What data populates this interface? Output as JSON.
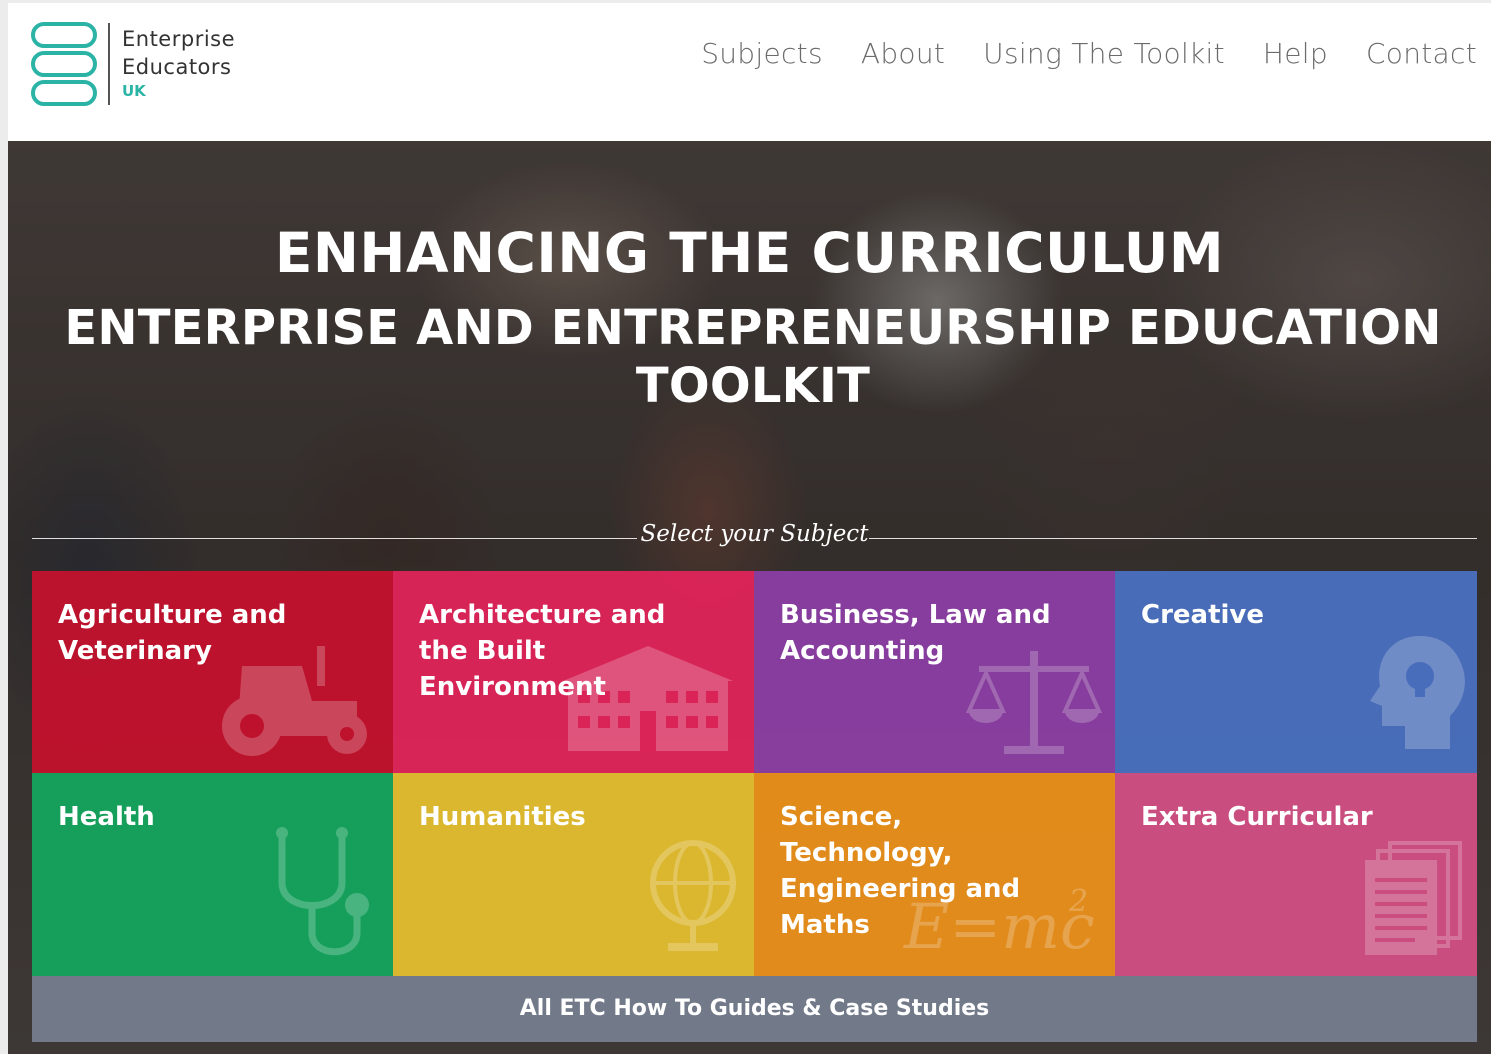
{
  "logo": {
    "line1": "Enterprise",
    "line2": "Educators",
    "line3": "UK",
    "accent_color": "#2bb3a6"
  },
  "nav": {
    "items": [
      "Subjects",
      "About",
      "Using The Toolkit",
      "Help",
      "Contact"
    ]
  },
  "hero": {
    "title": "ENHANCING THE CURRICULUM",
    "subtitle": "ENTERPRISE AND ENTREPRENEURSHIP EDUCATION TOOLKIT",
    "select_label": "Select your Subject"
  },
  "subjects": [
    {
      "label": "Agriculture and Veterinary",
      "color": "#c8102e",
      "icon": "tractor-icon"
    },
    {
      "label": "Architecture and the Built Environment",
      "color": "#e5245b",
      "icon": "building-icon"
    },
    {
      "label": "Business, Law and Accounting",
      "color": "#8e3fa7",
      "icon": "scales-icon"
    },
    {
      "label": "Creative",
      "color": "#4a72c4",
      "icon": "head-lightbulb-icon"
    },
    {
      "label": "Health",
      "color": "#14a85e",
      "icon": "stethoscope-icon"
    },
    {
      "label": "Humanities",
      "color": "#e9c230",
      "icon": "globe-icon"
    },
    {
      "label": "Science, Technology, Engineering and Maths",
      "color": "#f0921a",
      "icon": "formula-icon"
    },
    {
      "label": "Extra Curricular",
      "color": "#d64f86",
      "icon": "documents-icon"
    }
  ],
  "footer_button": {
    "label": "All ETC How To Guides & Case Studies"
  }
}
